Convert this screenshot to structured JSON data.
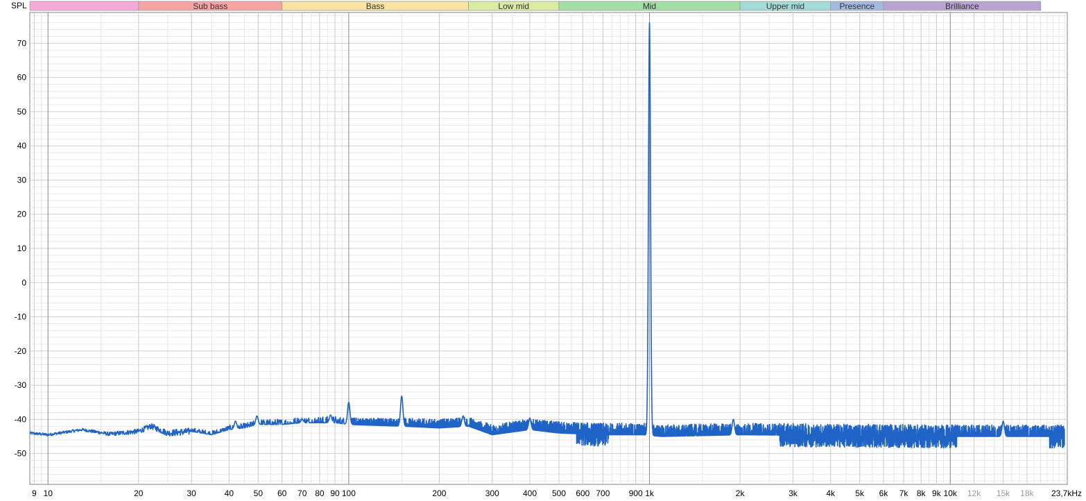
{
  "chart_data": {
    "type": "line",
    "ylabel": "SPL",
    "xunit_label": "23,7kHz",
    "x_scale": "log",
    "xlim": [
      8.7,
      24500
    ],
    "ylim": [
      -59,
      79
    ],
    "y_ticks": [
      70,
      60,
      50,
      40,
      30,
      20,
      10,
      0,
      -10,
      -20,
      -30,
      -40,
      -50
    ],
    "x_ticks": [
      {
        "v": 9,
        "label": "9",
        "light": false
      },
      {
        "v": 10,
        "label": "10",
        "light": false
      },
      {
        "v": 20,
        "label": "20",
        "light": false
      },
      {
        "v": 30,
        "label": "30",
        "light": false
      },
      {
        "v": 40,
        "label": "40",
        "light": false
      },
      {
        "v": 50,
        "label": "50",
        "light": false
      },
      {
        "v": 60,
        "label": "60",
        "light": false
      },
      {
        "v": 70,
        "label": "70",
        "light": false
      },
      {
        "v": 80,
        "label": "80",
        "light": false
      },
      {
        "v": 90,
        "label": "90",
        "light": false
      },
      {
        "v": 100,
        "label": "100",
        "light": false
      },
      {
        "v": 200,
        "label": "200",
        "light": false
      },
      {
        "v": 300,
        "label": "300",
        "light": false
      },
      {
        "v": 400,
        "label": "400",
        "light": false
      },
      {
        "v": 500,
        "label": "500",
        "light": false
      },
      {
        "v": 600,
        "label": "600",
        "light": false
      },
      {
        "v": 700,
        "label": "700",
        "light": false
      },
      {
        "v": 900,
        "label": "900",
        "light": false
      },
      {
        "v": 1000,
        "label": "1k",
        "light": false
      },
      {
        "v": 2000,
        "label": "2k",
        "light": false
      },
      {
        "v": 3000,
        "label": "3k",
        "light": false
      },
      {
        "v": 4000,
        "label": "4k",
        "light": false
      },
      {
        "v": 5000,
        "label": "5k",
        "light": false
      },
      {
        "v": 6000,
        "label": "6k",
        "light": false
      },
      {
        "v": 7000,
        "label": "7k",
        "light": false
      },
      {
        "v": 8000,
        "label": "8k",
        "light": false
      },
      {
        "v": 9000,
        "label": "9k",
        "light": false
      },
      {
        "v": 10000,
        "label": "10k",
        "light": false
      },
      {
        "v": 12000,
        "label": "12k",
        "light": true
      },
      {
        "v": 15000,
        "label": "15k",
        "light": true
      },
      {
        "v": 18000,
        "label": "18k",
        "light": true
      }
    ],
    "bands": [
      {
        "label": "",
        "from": 8.7,
        "to": 20,
        "color": "#f5a9d8"
      },
      {
        "label": "Sub bass",
        "from": 20,
        "to": 60,
        "color": "#f5a3a3"
      },
      {
        "label": "Bass",
        "from": 60,
        "to": 250,
        "color": "#f9e3a3"
      },
      {
        "label": "Low mid",
        "from": 250,
        "to": 500,
        "color": "#d8eca4"
      },
      {
        "label": "Mid",
        "from": 500,
        "to": 2000,
        "color": "#a4dea4"
      },
      {
        "label": "Upper mid",
        "from": 2000,
        "to": 4000,
        "color": "#a3dcd6"
      },
      {
        "label": "Presence",
        "from": 4000,
        "to": 6000,
        "color": "#a4b9e0"
      },
      {
        "label": "Brilliance",
        "from": 6000,
        "to": 20000,
        "color": "#b8a4d0"
      }
    ],
    "series": [
      {
        "color": "#1f63c6",
        "noise_floor": {
          "from": 8.7,
          "to": 24000,
          "level": -44,
          "spread": 3
        },
        "baseline": [
          [
            8.7,
            -44
          ],
          [
            10,
            -44.5
          ],
          [
            13,
            -43
          ],
          [
            16,
            -44.3
          ],
          [
            20,
            -43.5
          ],
          [
            22,
            -42
          ],
          [
            25,
            -44
          ],
          [
            30,
            -43.5
          ],
          [
            35,
            -44.5
          ],
          [
            40,
            -43
          ],
          [
            45,
            -42.5
          ],
          [
            50,
            -41.5
          ],
          [
            60,
            -41.5
          ],
          [
            70,
            -41
          ],
          [
            90,
            -41
          ],
          [
            100,
            -41.5
          ],
          [
            150,
            -42
          ],
          [
            200,
            -42.5
          ],
          [
            250,
            -42
          ],
          [
            300,
            -44.5
          ],
          [
            400,
            -43
          ],
          [
            500,
            -44
          ],
          [
            700,
            -44.5
          ],
          [
            950,
            -44.5
          ],
          [
            1100,
            -45
          ],
          [
            2000,
            -44.5
          ],
          [
            5000,
            -44.8
          ],
          [
            10000,
            -45
          ],
          [
            24000,
            -45
          ]
        ],
        "peaks": [
          {
            "x": 42,
            "y": -40.5
          },
          {
            "x": 49.5,
            "y": -39
          },
          {
            "x": 70,
            "y": -40
          },
          {
            "x": 87,
            "y": -38.7
          },
          {
            "x": 100,
            "y": -35
          },
          {
            "x": 150,
            "y": -33.2
          },
          {
            "x": 240,
            "y": -39
          },
          {
            "x": 400,
            "y": -39.6
          },
          {
            "x": 1000,
            "y": 76
          },
          {
            "x": 1900,
            "y": -40
          },
          {
            "x": 15000,
            "y": -40.5
          }
        ]
      }
    ]
  }
}
